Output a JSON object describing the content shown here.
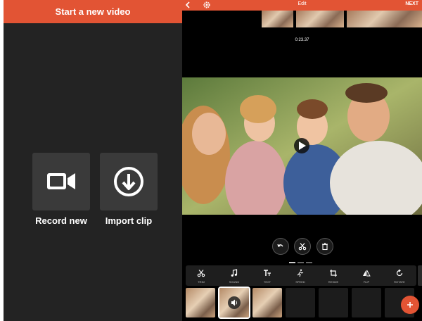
{
  "left": {
    "header_title": "Start a new video",
    "tiles": [
      {
        "label": "Record new",
        "icon": "video-camera-icon"
      },
      {
        "label": "Import clip",
        "icon": "download-circle-icon"
      }
    ]
  },
  "editor": {
    "title": "Edit",
    "next_label": "NEXT",
    "back_icon": "chevron-left-icon",
    "settings_icon": "gear-icon",
    "timecode": "0:23.37",
    "actions": [
      {
        "name": "undo",
        "icon": "undo-icon"
      },
      {
        "name": "split",
        "icon": "scissors-icon"
      },
      {
        "name": "delete",
        "icon": "trash-icon"
      }
    ],
    "tools": [
      {
        "label": "TRIM",
        "icon": "scissors-icon"
      },
      {
        "label": "SOUND",
        "icon": "music-note-icon"
      },
      {
        "label": "TEXT",
        "icon": "text-icon"
      },
      {
        "label": "SPEED",
        "icon": "running-icon"
      },
      {
        "label": "RESIZE",
        "icon": "crop-icon"
      },
      {
        "label": "FLIP",
        "icon": "flip-icon"
      },
      {
        "label": "ROTATE",
        "icon": "rotate-icon"
      }
    ],
    "clips": [
      {
        "type": "photo"
      },
      {
        "type": "photo",
        "selected": true,
        "icon": "speaker-icon"
      },
      {
        "type": "photo"
      },
      {
        "type": "empty"
      },
      {
        "type": "empty"
      },
      {
        "type": "empty"
      },
      {
        "type": "empty"
      }
    ],
    "add_icon": "plus-icon"
  },
  "colors": {
    "accent": "#e25434",
    "left_bg": "#232323",
    "tile_bg": "#3a3a3a",
    "editor_bg": "#000000"
  }
}
